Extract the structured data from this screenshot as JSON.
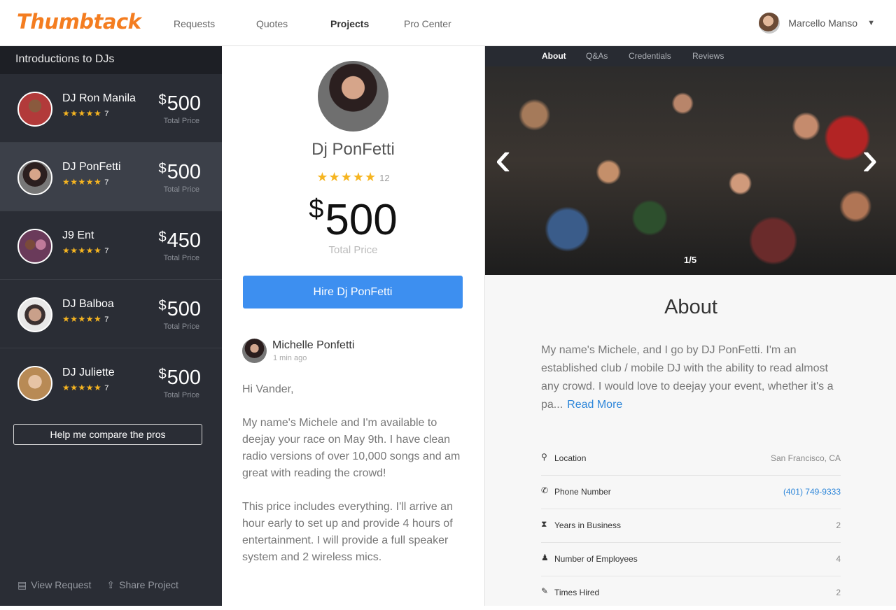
{
  "header": {
    "logo": "Thumbtack",
    "nav": [
      "Requests",
      "Quotes",
      "Projects",
      "Pro Center"
    ],
    "active_nav": "Projects",
    "user_name": "Marcello Manso",
    "caret": "▼"
  },
  "sidebar": {
    "title": "Introductions to DJs",
    "pros": [
      {
        "name": "DJ Ron Manila",
        "stars": "★★★★★",
        "reviews": "7",
        "dollar": "$",
        "price": "500",
        "price_label": "Total Price",
        "avatar_color": "#b23a3a"
      },
      {
        "name": "DJ PonFetti",
        "stars": "★★★★★",
        "reviews": "7",
        "dollar": "$",
        "price": "500",
        "price_label": "Total Price",
        "avatar_color": "#4a3a3a"
      },
      {
        "name": "J9 Ent",
        "stars": "★★★★★",
        "reviews": "7",
        "dollar": "$",
        "price": "450",
        "price_label": "Total Price",
        "avatar_color": "#8a4a6a"
      },
      {
        "name": "DJ Balboa",
        "stars": "★★★★★",
        "reviews": "7",
        "dollar": "$",
        "price": "500",
        "price_label": "Total Price",
        "avatar_color": "#9a8a7a"
      },
      {
        "name": "DJ Juliette",
        "stars": "★★★★★",
        "reviews": "7",
        "dollar": "$",
        "price": "500",
        "price_label": "Total Price",
        "avatar_color": "#c8a070"
      }
    ],
    "compare_label": "Help me compare the pros",
    "view_request": "View Request",
    "share_project": "Share Project"
  },
  "middle": {
    "name": "Dj PonFetti",
    "stars": "★★★★★",
    "reviews": "12",
    "dollar": "$",
    "price": "500",
    "price_label": "Total Price",
    "hire_label": "Hire Dj PonFetti",
    "message": {
      "author": "Michelle Ponfetti",
      "time": "1 min ago",
      "greeting": "Hi Vander,",
      "para1": "My name's Michele and I'm available to deejay your race on May 9th. I have clean radio versions of over 10,000 songs and am great with reading the crowd!",
      "para2": "This price includes everything. I'll arrive an hour early to set up and provide 4 hours of entertainment. I will provide a full speaker system and 2 wireless mics."
    }
  },
  "right": {
    "tabs": [
      "About",
      "Q&As",
      "Credentials",
      "Reviews"
    ],
    "active_tab": "About",
    "gallery_counter": "1/5",
    "about_title": "About",
    "about_text": "My name's Michele, and I go by DJ PonFetti. I'm an established club / mobile DJ with the ability to read almost any crowd. I would love to deejay your event, whether it's a pa...",
    "read_more": "Read More",
    "info": [
      {
        "icon": "location-icon",
        "label": "Location",
        "value": "San Francisco, CA"
      },
      {
        "icon": "phone-icon",
        "label": "Phone Number",
        "value": "(401) 749-9333"
      },
      {
        "icon": "hourglass-icon",
        "label": "Years in Business",
        "value": "2"
      },
      {
        "icon": "people-icon",
        "label": "Number of Employees",
        "value": "4"
      },
      {
        "icon": "pin-icon",
        "label": "Times Hired",
        "value": "2"
      }
    ]
  },
  "colors": {
    "brand": "#f47d20",
    "sidebar_bg": "#2a2d35",
    "hire_button": "#3d8ff0",
    "star": "#f6b521",
    "link": "#2d86d9"
  }
}
